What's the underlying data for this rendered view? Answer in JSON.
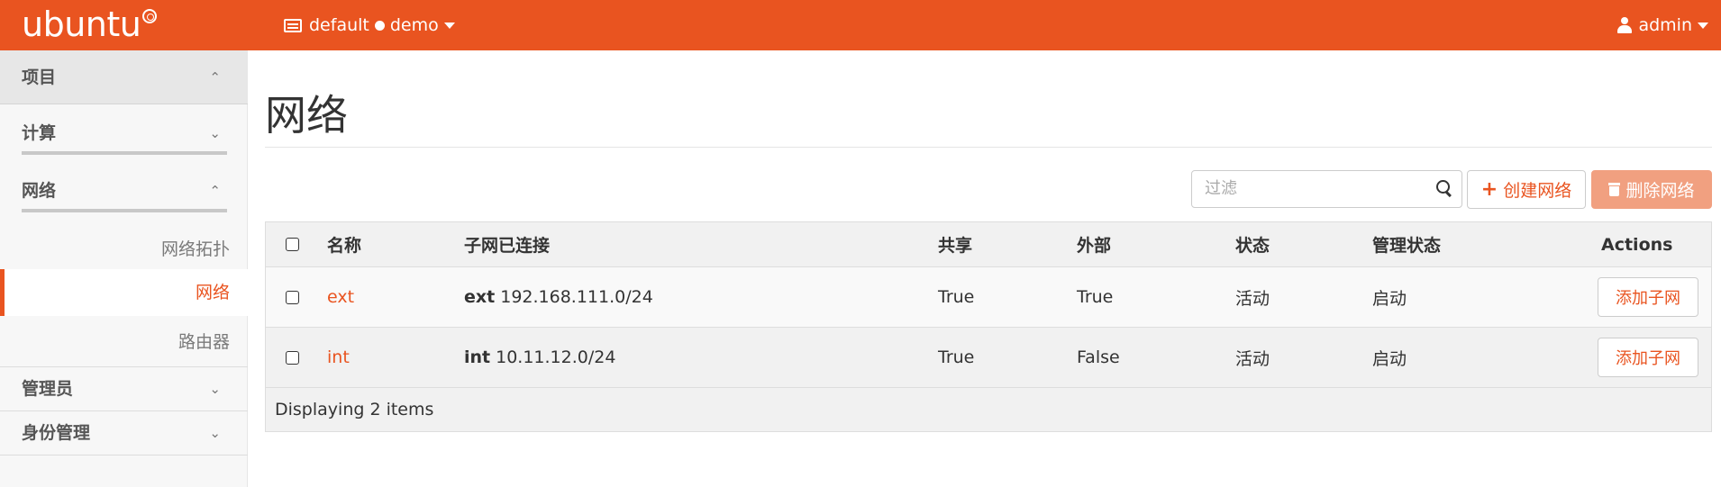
{
  "brand": {
    "text": "ubuntu"
  },
  "header": {
    "project_domain": "default",
    "project_name": "demo",
    "user": "admin"
  },
  "sidebar": {
    "sections": [
      {
        "label": "项目",
        "chevron": "⌃"
      },
      {
        "label": "计算",
        "chevron": "⌄"
      },
      {
        "label": "网络",
        "chevron": "⌃"
      },
      {
        "label": "管理员",
        "chevron": "⌄"
      },
      {
        "label": "身份管理",
        "chevron": "⌄"
      }
    ],
    "network_items": [
      {
        "label": "网络拓扑"
      },
      {
        "label": "网络",
        "active": true
      },
      {
        "label": "路由器"
      }
    ]
  },
  "page": {
    "title": "网络",
    "filter_placeholder": "过滤",
    "create_button": "创建网络",
    "delete_button": "删除网络"
  },
  "table": {
    "columns": [
      "名称",
      "子网已连接",
      "共享",
      "外部",
      "状态",
      "管理状态",
      "Actions"
    ],
    "rows": [
      {
        "name": "ext",
        "subnet_name": "ext",
        "subnet_cidr": "192.168.111.0/24",
        "shared": "True",
        "external": "True",
        "status": "活动",
        "admin_state": "启动",
        "action": "添加子网"
      },
      {
        "name": "int",
        "subnet_name": "int",
        "subnet_cidr": "10.11.12.0/24",
        "shared": "True",
        "external": "False",
        "status": "活动",
        "admin_state": "启动",
        "action": "添加子网"
      }
    ],
    "footer": "Displaying 2 items"
  },
  "colors": {
    "accent": "#e95420",
    "delete_disabled": "#f19b7a"
  }
}
